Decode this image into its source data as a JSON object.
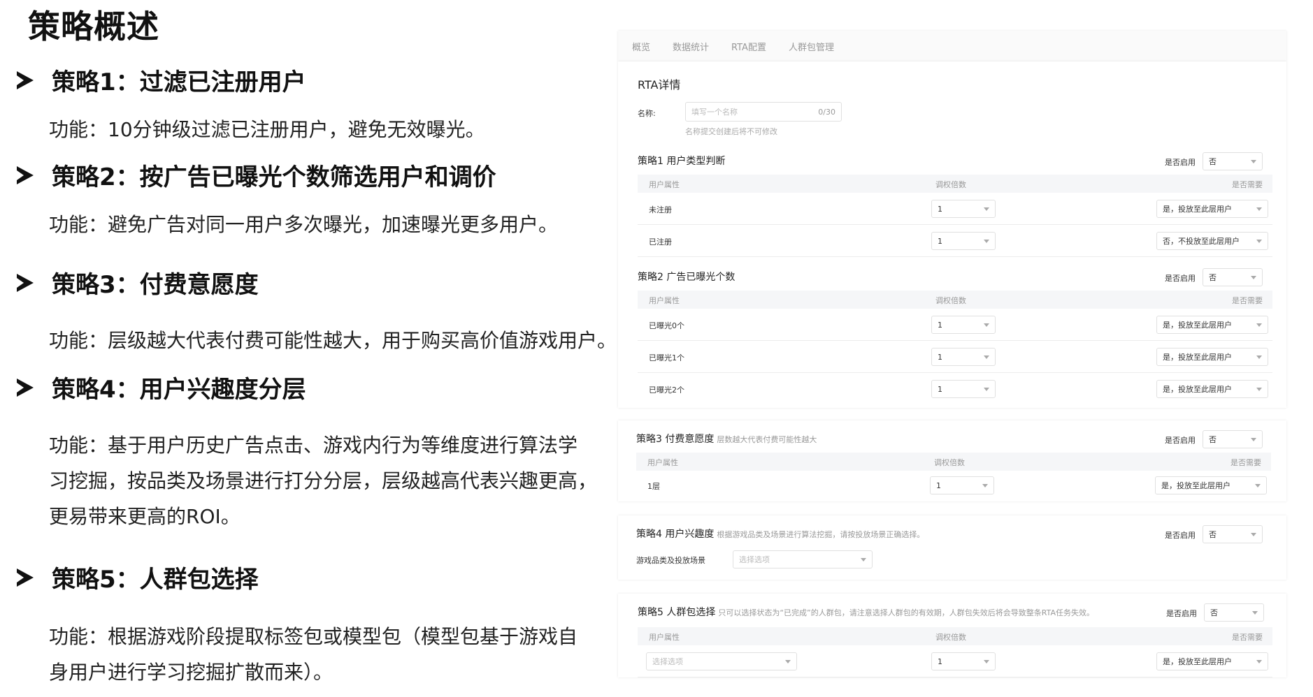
{
  "slide": {
    "title": "策略概述",
    "strategies": [
      {
        "heading": "策略1：过滤已注册用户",
        "desc": [
          "功能：10分钟级过滤已注册用户，避免无效曝光。"
        ]
      },
      {
        "heading": "策略2：按广告已曝光个数筛选用户和调价",
        "desc": [
          "功能：避免广告对同一用户多次曝光，加速曝光更多用户。"
        ]
      },
      {
        "heading": "策略3：付费意愿度",
        "desc": [
          "功能：层级越大代表付费可能性越大，用于购买高价值游戏用户。"
        ]
      },
      {
        "heading": "策略4：用户兴趣度分层",
        "desc": [
          "功能：基于用户历史广告点击、游戏内行为等维度进行算法学",
          "习挖掘，按品类及场景进行打分分层，层级越高代表兴趣更高，",
          "更易带来更高的ROI。"
        ]
      },
      {
        "heading": "策略5：人群包选择",
        "desc": [
          "功能：根据游戏阶段提取标签包或模型包（模型包基于游戏自",
          "身用户进行学习挖掘扩散而来）。"
        ]
      }
    ]
  },
  "app": {
    "tabs": [
      "概览",
      "数据统计",
      "RTA配置",
      "人群包管理"
    ],
    "rta_title": "RTA详情",
    "name_label": "名称:",
    "name_placeholder": "填写一个名称",
    "name_count": "0/30",
    "name_hint": "名称提交创建后将不可修改",
    "enable_label": "是否启用",
    "enable_value": "否",
    "col_attr": "用户属性",
    "col_multiplier": "调权倍数",
    "col_need": "是否需要",
    "opt_yes": "是，投放至此层用户",
    "opt_no": "否，不投放至此层用户",
    "multiplier_value": "1",
    "select_placeholder": "选择选项",
    "s1": {
      "title": "策略1 用户类型判断",
      "rows": [
        "未注册",
        "已注册"
      ]
    },
    "s2": {
      "title": "策略2 广告已曝光个数",
      "rows": [
        "已曝光0个",
        "已曝光1个",
        "已曝光2个"
      ]
    },
    "s3": {
      "title": "策略3 付费意愿度",
      "hint": "层数越大代表付费可能性越大",
      "rows": [
        "1层"
      ]
    },
    "s4": {
      "title": "策略4 用户兴趣度",
      "hint": "根据游戏品类及场景进行算法挖掘，请按投放场景正确选择。",
      "field_label": "游戏品类及投放场景"
    },
    "s5": {
      "title": "策略5 人群包选择",
      "hint": "只可以选择状态为“已完成”的人群包，请注意选择人群包的有效期，人群包失效后将会导致整条RTA任务失效。"
    }
  }
}
